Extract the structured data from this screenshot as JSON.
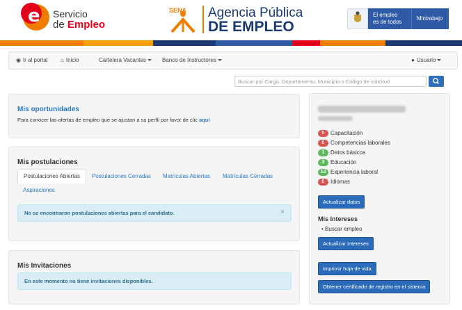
{
  "header": {
    "sde_line1": "Servicio",
    "sde_line2a": "de ",
    "sde_line2b": "Empleo",
    "sena_label": "SENA",
    "apde_line1": "Agencia Pública",
    "apde_line2": "DE EMPLEO",
    "gov_line1": "El empleo",
    "gov_line2": "es de todos",
    "gov_ministry": "Mintrabajo"
  },
  "nav": {
    "portal": "Ir al portal",
    "inicio": "Inicio",
    "cartelera": "Cartelera Vacantes",
    "banco": "Banco de Instructores",
    "usuario": "Usuario"
  },
  "search": {
    "placeholder": "Buscar por Cargo, Departamento, Municipio o Código de solicitud"
  },
  "oportunidades": {
    "title": "Mis oportunidades",
    "text": "Para conocer las ofertas de empleo que se ajustan a su perfil por favor de clic ",
    "link": "aquí"
  },
  "postulaciones": {
    "title": "Mis postulaciones",
    "tabs": [
      "Postulaciones Abiertas",
      "Postulaciones Cerradas",
      "Matrículas Abiertas",
      "Matrículas Cerradas",
      "Aspiraciones"
    ],
    "alert": "No se encontraron postulaciones abiertas para el candidato.",
    "close": "×"
  },
  "invitaciones": {
    "title": "Mis Invitaciones",
    "alert": "En este momento no tiene invitaciones disponibles."
  },
  "profile": {
    "items": [
      {
        "count": "0",
        "label": "Capacitación",
        "color": "#d9534f"
      },
      {
        "count": "0",
        "label": "Competencias laborales",
        "color": "#d9534f"
      },
      {
        "count": "1",
        "label": "Datos básicos",
        "color": "#5cb85c"
      },
      {
        "count": "3",
        "label": "Educación",
        "color": "#5cb85c"
      },
      {
        "count": "13",
        "label": "Experiencia laboral",
        "color": "#5cb85c"
      },
      {
        "count": "0",
        "label": "Idiomas",
        "color": "#d9534f"
      }
    ],
    "update_btn": "Actualizar datos",
    "interests_title": "Mis Intereses",
    "interest_item": "Buscar empleo",
    "update_interests_btn": "Actualizar Intereses",
    "print_btn": "Imprimir hoja de vida",
    "certificate_btn": "Obtener certificado de registro en el sistema"
  },
  "colors": {
    "stripe": [
      "#f07d00",
      "#f07d00",
      "#1b3a73",
      "#1b3a73",
      "#e2001a",
      "#f07d00",
      "#1b3a73"
    ]
  }
}
